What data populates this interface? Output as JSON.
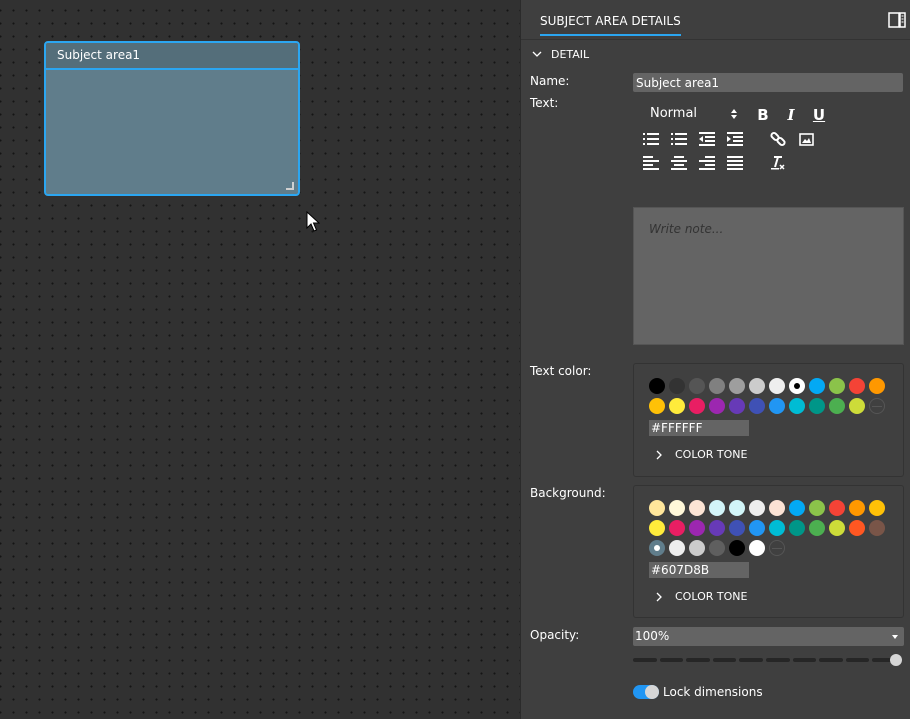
{
  "canvas": {
    "subject_area": {
      "title": "Subject area1",
      "background_color": "#607D8B",
      "selected": true
    }
  },
  "panel": {
    "tab_label": "SUBJECT AREA DETAILS",
    "toggle_icon": "panel-layout-icon",
    "section_label": "DETAIL",
    "name_label": "Name:",
    "name_value": "Subject area1",
    "text_label": "Text:",
    "toolbar": {
      "font_style": "Normal",
      "bold": "B",
      "italic": "I",
      "underline": "U",
      "icons": [
        "ordered-list-icon",
        "bullet-list-icon",
        "outdent-icon",
        "indent-icon",
        "link-icon",
        "image-icon",
        "align-left-icon",
        "align-center-icon",
        "align-right-icon",
        "align-justify-icon",
        "clear-format-icon"
      ]
    },
    "note_placeholder": "Write note...",
    "text_color": {
      "label": "Text color:",
      "swatches": [
        "#000000",
        "#333333",
        "#555555",
        "#808080",
        "#9e9e9e",
        "#cccccc",
        "#eeeeee",
        "#ffffff",
        "#03a9f4",
        "#8bc34a",
        "#f44336",
        "#ff9800",
        "#ffc107",
        "#ffeb3b",
        "#e91e63",
        "#9c27b0",
        "#673ab7",
        "#3f51b5",
        "#2196f3",
        "#00bcd4",
        "#009688",
        "#4caf50",
        "#cddc39",
        "none"
      ],
      "selected": "#ffffff",
      "hex_value": "#FFFFFF",
      "tone_label": "COLOR TONE"
    },
    "background": {
      "label": "Background:",
      "swatches": [
        "#ffe69b",
        "#fff8d9",
        "#fce4d4",
        "#d2f4f8",
        "#d1f5f8",
        "#eeeeee",
        "#fce2d4",
        "#03a9f4",
        "#8bc34a",
        "#f44336",
        "#ff9800",
        "#ffc107",
        "#ffeb3b",
        "#e91e63",
        "#9c27b0",
        "#673ab7",
        "#3f51b5",
        "#2196f3",
        "#00bcd4",
        "#009688",
        "#4caf50",
        "#cddc39",
        "#ff5722",
        "#795548",
        "#607d8b",
        "#eeeeee",
        "#cccccc",
        "#5f5f5f",
        "#000000",
        "#ffffff",
        "none"
      ],
      "selected": "#607d8b",
      "hex_value": "#607D8B",
      "tone_label": "COLOR TONE"
    },
    "opacity": {
      "label": "Opacity:",
      "value": "100%",
      "fraction": 1.0
    },
    "lock_dimensions": {
      "label": "Lock dimensions",
      "checked": true
    }
  }
}
